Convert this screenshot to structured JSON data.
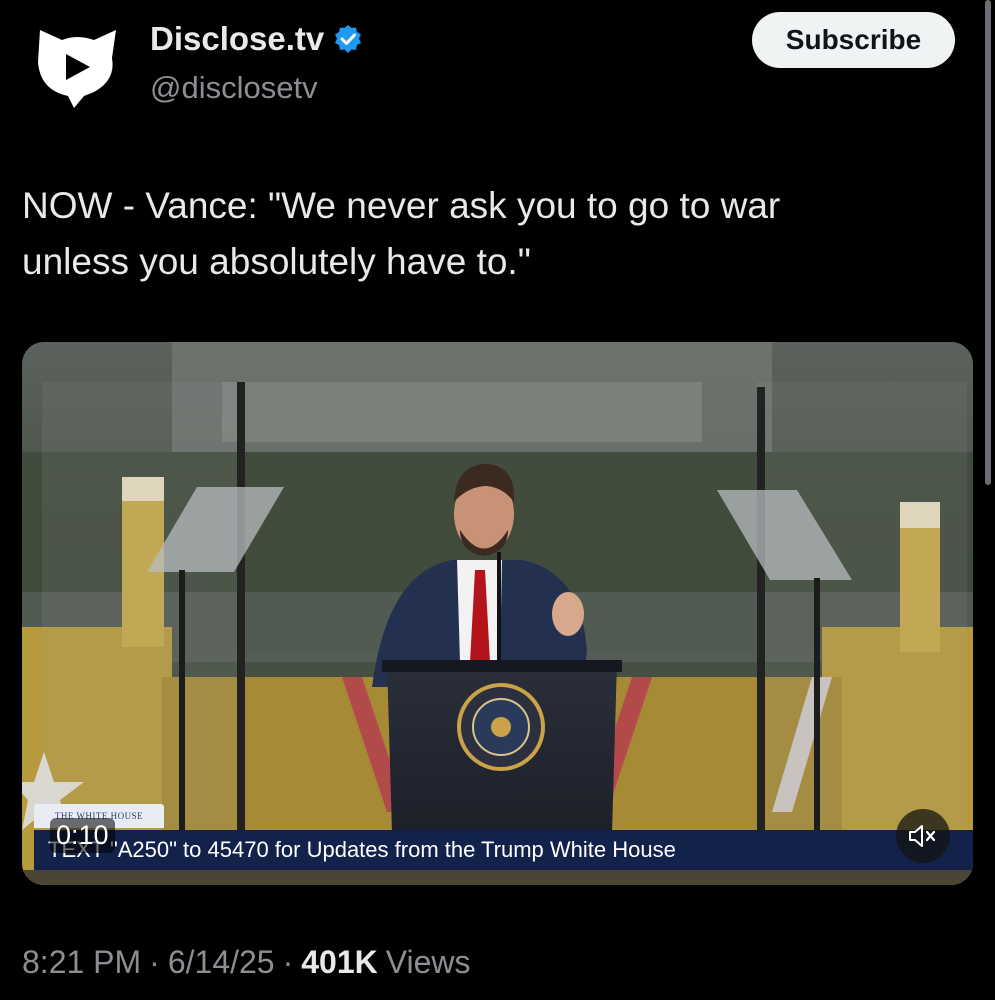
{
  "account": {
    "display_name": "Disclose.tv",
    "handle": "@disclosetv",
    "verified": true,
    "avatar_icon": "disclose-tv-logo-icon",
    "verified_icon": "verified-badge-icon",
    "verified_color": "#1d9bf0"
  },
  "subscribe_label": "Subscribe",
  "tweet": {
    "text": "NOW - Vance: \"We never ask you to go to war\nunless you absolutely have to.\""
  },
  "video": {
    "ticker_text": "TEXT \"A250\" to 45470 for Updates from the Trump White House",
    "watermark": "THE WHITE HOUSE",
    "timestamp": "0:10",
    "mute_icon": "speaker-muted-icon"
  },
  "meta": {
    "time": "8:21 PM",
    "date": "6/14/25",
    "separator": "·",
    "views_count": "401K",
    "views_label": "Views"
  }
}
